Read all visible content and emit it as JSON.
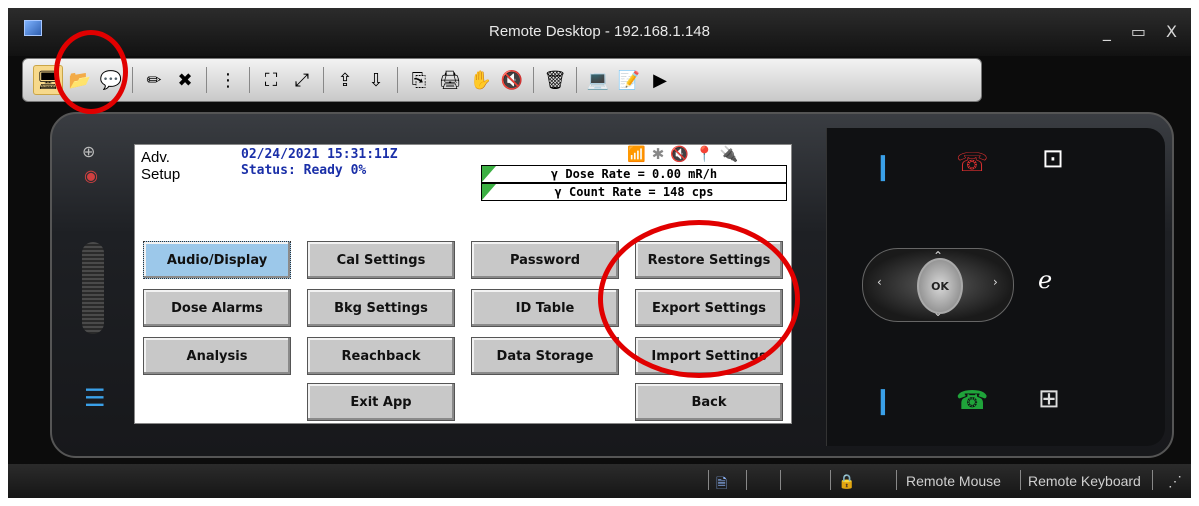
{
  "window": {
    "title": "Remote Desktop - 192.168.1.148",
    "minimize": "_",
    "maximize": "▭",
    "close": "X"
  },
  "toolbar": {
    "icons": [
      "connect-icon",
      "open-folder-icon",
      "chat-icon",
      "pen-icon",
      "delete-icon",
      "grid-menu-icon",
      "fit-screen-icon",
      "fullscreen-icon",
      "export-icon",
      "import-icon",
      "copy-icon",
      "print-icon",
      "hand-icon",
      "mute-icon",
      "tools-icon",
      "computer-icon",
      "notes-icon",
      "send-icon"
    ],
    "glyphs": [
      "🖥",
      "📂",
      "💬",
      "✏",
      "✖",
      "⋮",
      "⛶",
      "⤢",
      "⇪",
      "⇩",
      "⎘",
      "🖨",
      "✋",
      "🔇",
      "🗑",
      "💻",
      "📝",
      "▶"
    ]
  },
  "device_screen": {
    "header_line1": "Adv.",
    "header_line2": "Setup",
    "datetime": "02/24/2021 15:31:11Z",
    "status": "Status: Ready 0%",
    "dose_rate": "γ Dose Rate = 0.00 mR/h",
    "count_rate": "γ Count Rate = 148 cps",
    "status_icons": [
      "wifi-icon",
      "bluetooth-icon",
      "speaker-muted-icon",
      "gps-icon",
      "battery-plug-icon"
    ],
    "status_glyphs": [
      "📶",
      "✱",
      "🔇",
      "📍",
      "🔌"
    ],
    "buttons": {
      "audio_display": "Audio/Display",
      "cal_settings": "Cal Settings",
      "password": "Password",
      "restore_settings": "Restore Settings",
      "dose_alarms": "Dose Alarms",
      "bkg_settings": "Bkg Settings",
      "id_table": "ID Table",
      "export_settings": "Export Settings",
      "analysis": "Analysis",
      "reachback": "Reachback",
      "data_storage": "Data Storage",
      "import_settings": "Import Settings",
      "exit_app": "Exit App",
      "back": "Back"
    }
  },
  "hardware": {
    "ok_label": "OK"
  },
  "statusbar": {
    "remote_mouse": "Remote Mouse",
    "remote_keyboard": "Remote Keyboard"
  },
  "colors": {
    "annotation_circle": "#e10000",
    "selected_button": "#9cc8ea",
    "status_text": "#1a2fa8"
  }
}
